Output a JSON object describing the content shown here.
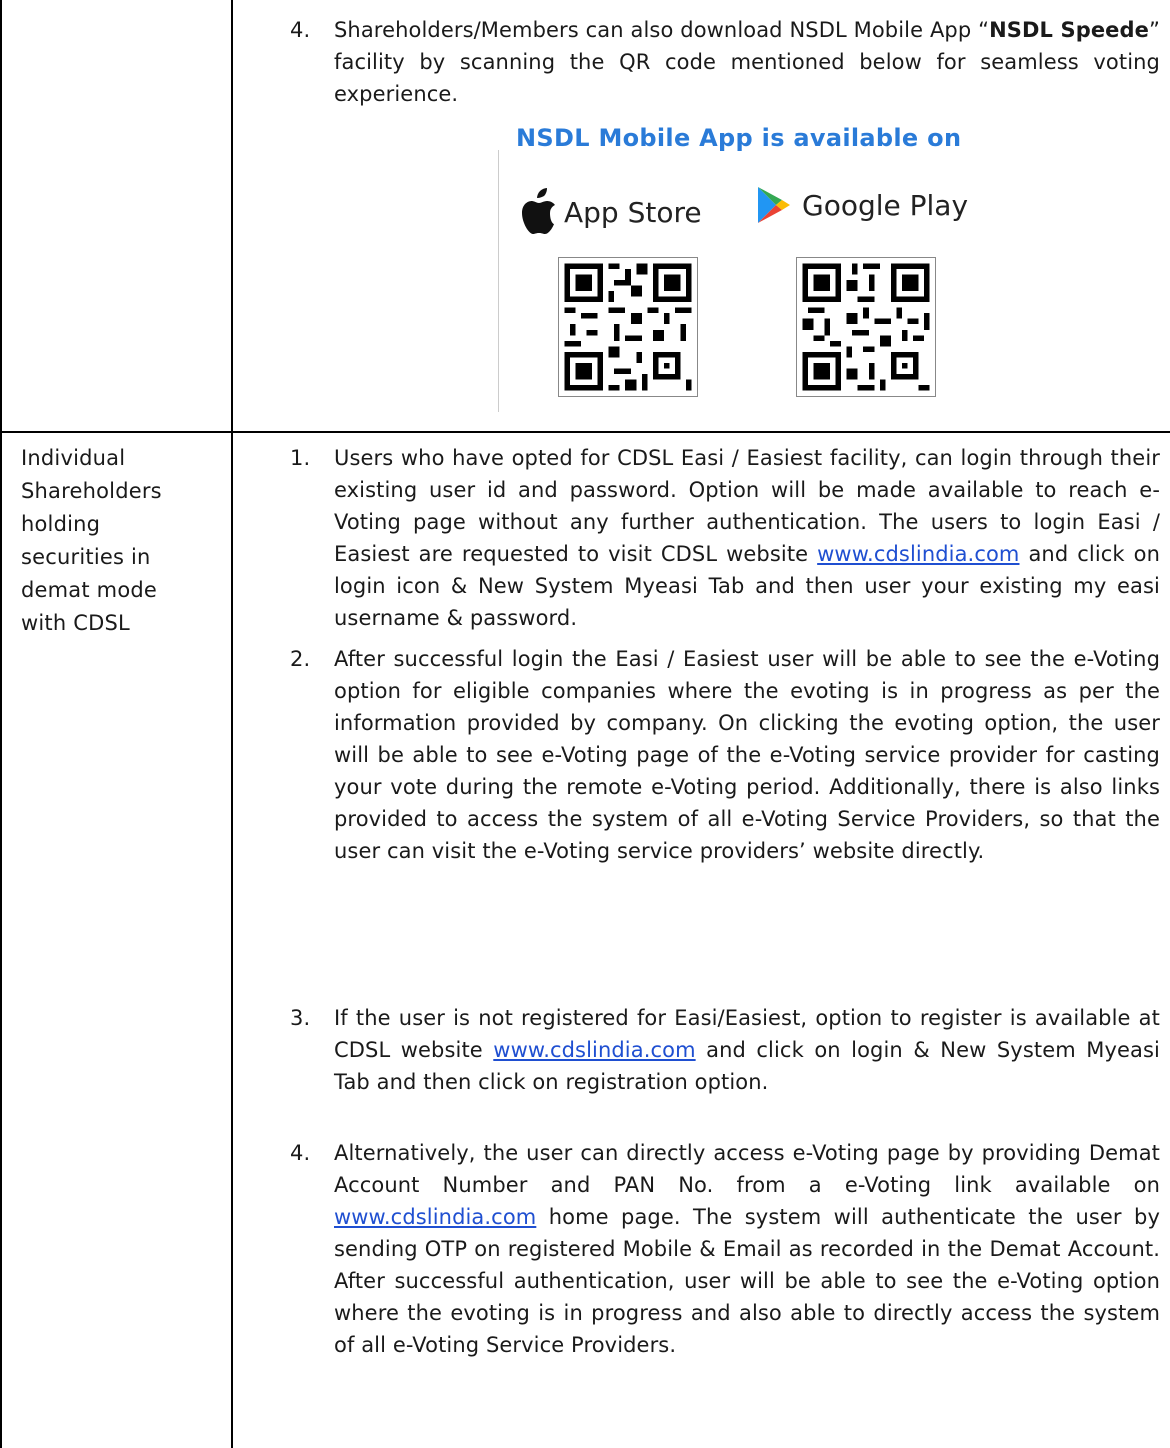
{
  "top_item": {
    "number": "4.",
    "text_before": "Shareholders/Members can also download NSDL Mobile App “",
    "bold_text": "NSDL Speede",
    "text_after": "” facility by scanning the QR code mentioned below for seamless voting experience."
  },
  "app_box": {
    "title": "NSDL Mobile App is available on",
    "apple_label": "App Store",
    "google_label": "Google Play",
    "apple_icon": "apple-icon",
    "google_icon": "google-play-icon",
    "title_color": "#2a7bd8"
  },
  "left_cell": {
    "lines": [
      "Individual",
      "Shareholders",
      "holding",
      "securities in",
      "demat mode",
      "with CDSL"
    ]
  },
  "items": [
    {
      "number": "1.",
      "before": "Users who have opted for CDSL Easi / Easiest facility, can login through their existing user id and password. Option will be made available to reach e-Voting page without any further authentication. The users to login Easi / Easiest are requested to visit CDSL website ",
      "link": "www.cdslindia.com",
      "after": " and click on login icon & New System Myeasi Tab and then user your existing my easi username & password."
    },
    {
      "number": "2.",
      "before": "After successful login the Easi / Easiest user will be able to see the e-Voting option for eligible companies where the evoting is in progress as per the information provided by company. On clicking the evoting option, the user will be able to see e-Voting page of the e-Voting service provider for casting your vote during the remote e-Voting period. Additionally, there is also links provided to access the system of all e-Voting Service Providers, so that the user can visit the e-Voting service providers’ website directly.",
      "link": "",
      "after": ""
    },
    {
      "number": "3.",
      "before": "If the user is not registered for Easi/Easiest, option to register is available at CDSL website ",
      "link": "www.cdslindia.com",
      "after": " and click on login & New System Myeasi Tab and then click on registration option."
    },
    {
      "number": "4.",
      "before": "Alternatively, the user can directly access e-Voting page by providing Demat Account Number and PAN No. from a e-Voting link available on ",
      "link": "www.cdslindia.com",
      "after": " home page. The system will authenticate the user by sending OTP on registered Mobile & Email as recorded in the Demat Account. After successful authentication, user will be able to see the e-Voting option where the evoting is in progress and also able to directly access the system of all e-Voting Service Providers."
    }
  ],
  "link_color": "#1f4fd1"
}
